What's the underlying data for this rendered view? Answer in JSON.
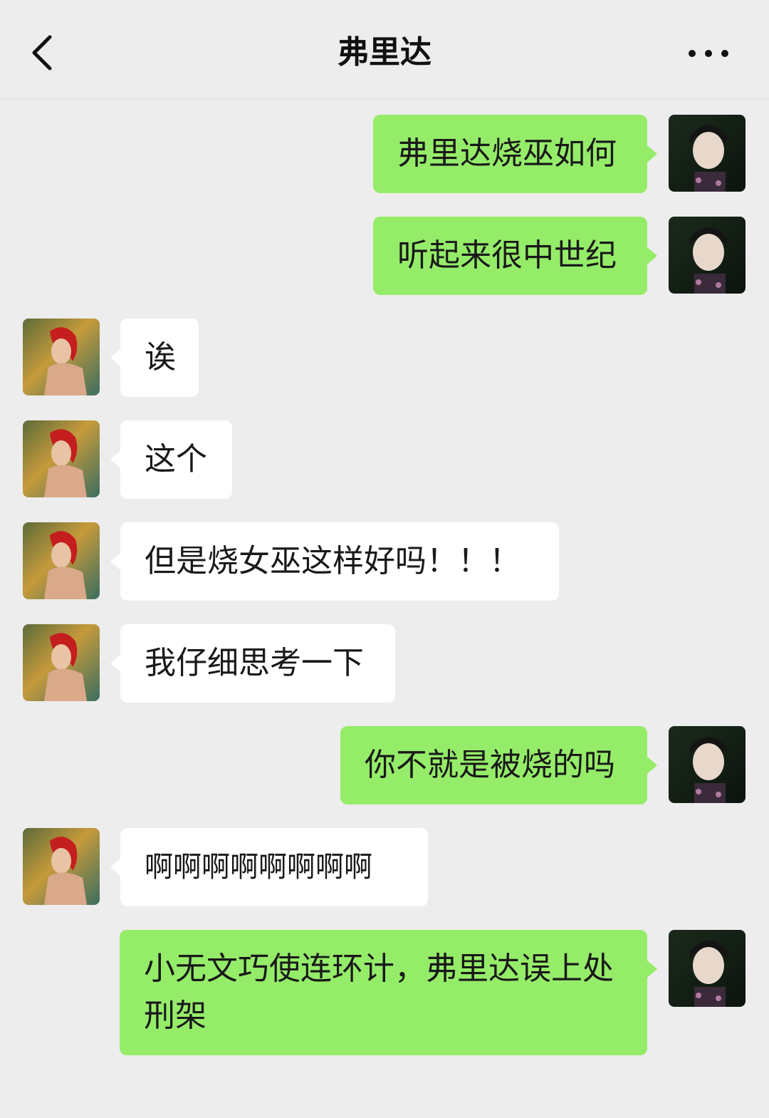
{
  "header": {
    "title": "弗里达",
    "back_icon": "chevron-left-icon",
    "more_icon": "more-dots-icon"
  },
  "colors": {
    "background": "#ededed",
    "my_bubble": "#95ec69",
    "their_bubble": "#ffffff"
  },
  "messages": [
    {
      "sender": "me",
      "text": "弗里达烧巫如何"
    },
    {
      "sender": "me",
      "text": "听起来很中世纪"
    },
    {
      "sender": "them",
      "text": "诶"
    },
    {
      "sender": "them",
      "text": "这个"
    },
    {
      "sender": "them",
      "text": "但是烧女巫这样好吗！！！"
    },
    {
      "sender": "them",
      "text": "我仔细思考一下"
    },
    {
      "sender": "me",
      "text": "你不就是被烧的吗"
    },
    {
      "sender": "them",
      "text": "啊啊啊啊啊啊啊啊"
    },
    {
      "sender": "me",
      "text": "小无文巧使连环计，弗里达误上处刑架"
    }
  ]
}
